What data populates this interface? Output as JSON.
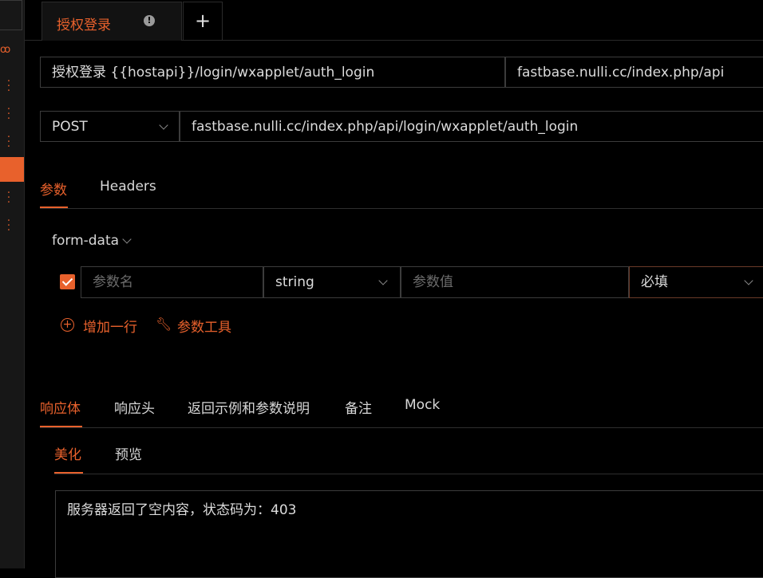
{
  "tab": {
    "label": "授权登录",
    "add_label": "+"
  },
  "api": {
    "name_path": "授权登录 {{hostapi}}/login/wxapplet/auth_login",
    "host": "fastbase.nulli.cc/index.php/api",
    "method": "POST",
    "full_url": "fastbase.nulli.cc/index.php/api/login/wxapplet/auth_login"
  },
  "sections": {
    "params_tab": "参数",
    "headers_tab": "Headers"
  },
  "body_type": "form-data",
  "param_row": {
    "checked": true,
    "name_placeholder": "参数名",
    "type": "string",
    "value_placeholder": "参数值",
    "required": "必填"
  },
  "actions": {
    "add_row": "增加一行",
    "param_tools": "参数工具"
  },
  "response_tabs": [
    "响应体",
    "响应头",
    "返回示例和参数说明",
    "备注",
    "Mock"
  ],
  "view_tabs": [
    "美化",
    "预览"
  ],
  "response_text": "服务器返回了空内容，状态码为：403",
  "colors": {
    "accent": "#e8612c",
    "background": "#000000",
    "border": "#3c3c3c"
  },
  "icons": [
    "alert-circle-icon",
    "plus-icon",
    "chevron-down-icon",
    "add-circle-icon",
    "wrench-icon",
    "more-vertical-icon"
  ]
}
